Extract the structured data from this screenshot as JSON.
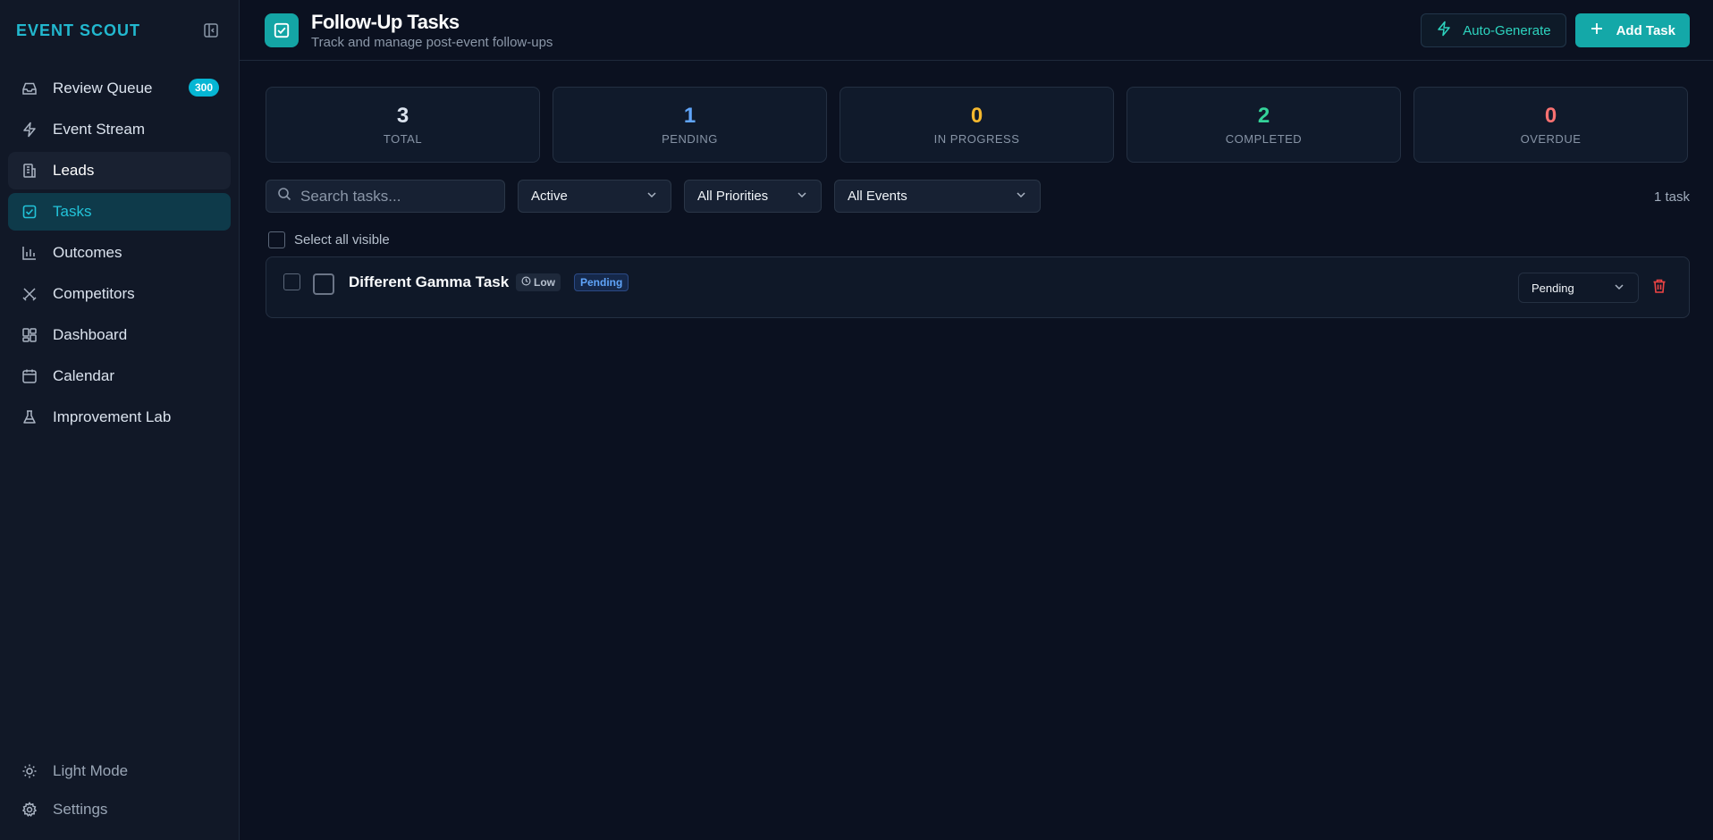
{
  "app": {
    "brand": "EVENT SCOUT"
  },
  "sidebar": {
    "items": [
      {
        "label": "Review Queue",
        "icon": "inbox-icon",
        "badge": "300"
      },
      {
        "label": "Event Stream",
        "icon": "lightning-icon"
      },
      {
        "label": "Leads",
        "icon": "building-icon"
      },
      {
        "label": "Tasks",
        "icon": "checkbox-icon"
      },
      {
        "label": "Outcomes",
        "icon": "bar-chart-icon"
      },
      {
        "label": "Competitors",
        "icon": "swords-icon"
      },
      {
        "label": "Dashboard",
        "icon": "grid-icon"
      },
      {
        "label": "Calendar",
        "icon": "calendar-icon"
      },
      {
        "label": "Improvement Lab",
        "icon": "flask-icon"
      }
    ],
    "active": "Tasks",
    "hovered": "Leads",
    "bottom": [
      {
        "label": "Light Mode",
        "icon": "sun-icon"
      },
      {
        "label": "Settings",
        "icon": "gear-icon"
      }
    ]
  },
  "header": {
    "title": "Follow-Up Tasks",
    "subtitle": "Track and manage post-event follow-ups",
    "auto_generate": "Auto-Generate",
    "add_task": "Add Task"
  },
  "stats": [
    {
      "value": "3",
      "label": "TOTAL",
      "color": "#dbe3ee"
    },
    {
      "value": "1",
      "label": "PENDING",
      "color": "#60a5fa"
    },
    {
      "value": "0",
      "label": "IN PROGRESS",
      "color": "#f5b82e"
    },
    {
      "value": "2",
      "label": "COMPLETED",
      "color": "#34d399"
    },
    {
      "value": "0",
      "label": "OVERDUE",
      "color": "#f87171"
    }
  ],
  "filters": {
    "search_placeholder": "Search tasks...",
    "status": "Active",
    "priority": "All Priorities",
    "event": "All Events",
    "count": "1 task"
  },
  "select_all": "Select all visible",
  "tasks": [
    {
      "title": "Different Gamma Task",
      "priority": "Low",
      "status_badge": "Pending",
      "status_select": "Pending"
    }
  ],
  "colors": {
    "accent": "#14a8a8",
    "brand": "#22b8cf",
    "danger": "#ef4444"
  }
}
